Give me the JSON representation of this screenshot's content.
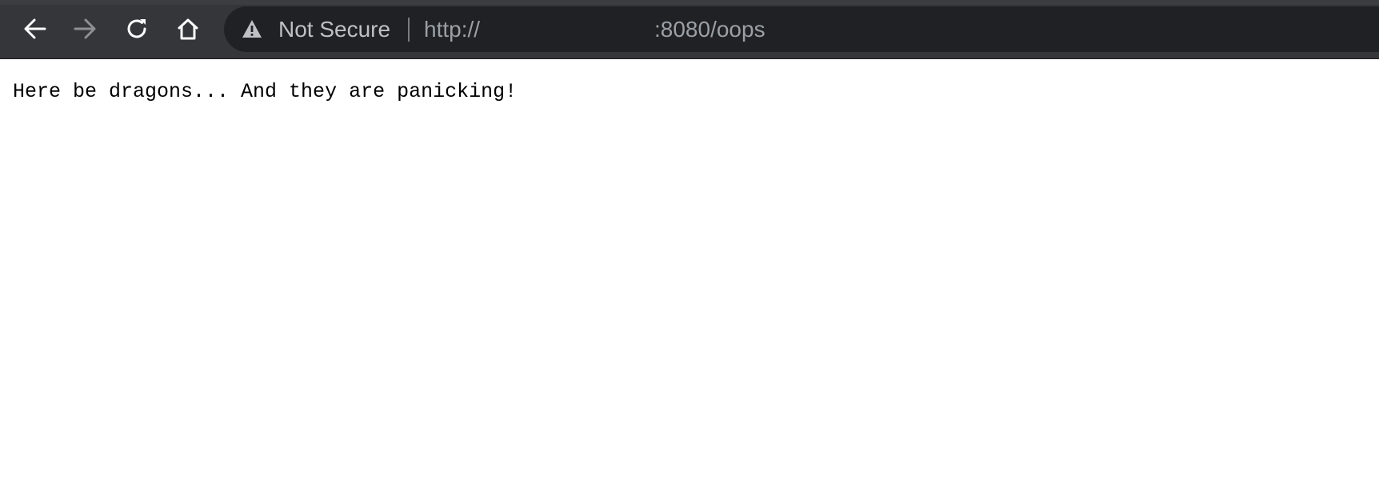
{
  "browser": {
    "toolbar": {
      "back_icon": "arrow-left-icon",
      "forward_icon": "arrow-right-icon",
      "reload_icon": "reload-icon",
      "home_icon": "home-icon"
    },
    "omnibox": {
      "security_icon": "warning-triangle-icon",
      "security_label": "Not Secure",
      "url_scheme": "http://",
      "url_rest": ":8080/oops"
    },
    "colors": {
      "toolbar_bg": "#35363a",
      "omnibox_bg": "#202124",
      "icon_active": "#ffffff",
      "icon_disabled": "#8e9094",
      "url_text": "#9aa0a6"
    }
  },
  "page": {
    "message": "Here be dragons... And they are panicking!"
  }
}
